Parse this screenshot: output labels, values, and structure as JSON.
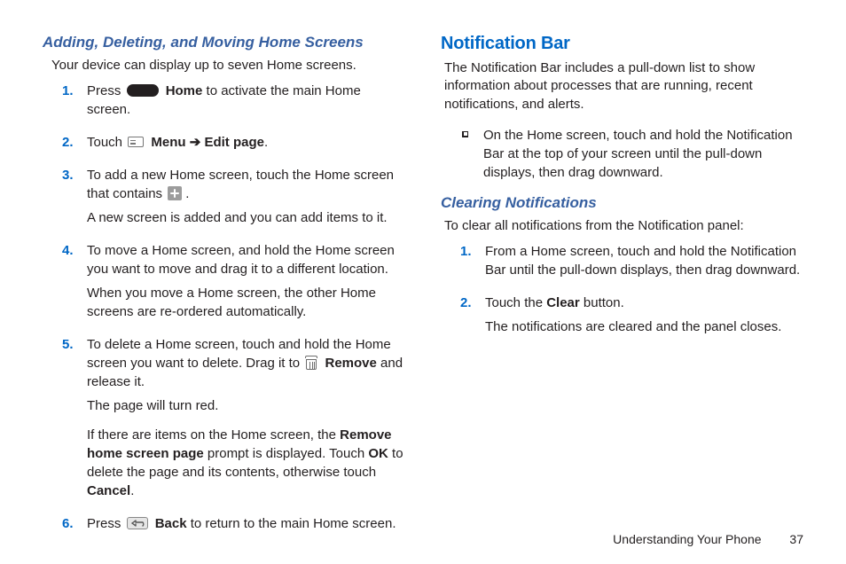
{
  "left": {
    "heading": "Adding, Deleting, and Moving Home Screens",
    "intro": "Your device can display up to seven Home screens.",
    "steps": {
      "s1a": "Press ",
      "s1b": "Home",
      "s1c": " to activate the main Home screen.",
      "s2a": "Touch ",
      "s2b": "Menu",
      "s2c": "Edit page",
      "s2d": ".",
      "arrow": " ➔ ",
      "s3a": "To add a new Home screen, touch the Home screen that contains ",
      "s3b": ".",
      "s3c": "A new screen is added and you can add items to it.",
      "s4a": "To move a Home screen, and hold the Home screen you want to move and drag it to a different location.",
      "s4b": "When you move a Home screen, the other Home screens are re-ordered automatically.",
      "s5a": "To delete a Home screen, touch and hold the Home screen you want to delete. Drag it to ",
      "s5b": "Remove",
      "s5c": " and release it.",
      "s5d": "The page will turn red.",
      "s5e": "If there are items on the Home screen, the ",
      "s5f": "Remove home screen page",
      "s5g": " prompt is displayed. Touch ",
      "s5h": "OK",
      "s5i": " to delete the page and its contents, otherwise touch ",
      "s5j": "Cancel",
      "s5k": ".",
      "s6a": "Press ",
      "s6b": "Back",
      "s6c": " to return to the main Home screen."
    }
  },
  "right": {
    "heading": "Notification Bar",
    "intro": "The Notification Bar includes a pull-down list to show information about processes that are running, recent notifications, and alerts.",
    "bullet": "On the Home screen, touch and hold the Notification Bar at the top of your screen until the pull-down displays, then drag downward.",
    "sub_heading": "Clearing Notifications",
    "sub_intro": "To clear all notifications from the Notification panel:",
    "steps": {
      "s1": "From a Home screen, touch and hold the Notification Bar until the pull-down displays, then drag downward.",
      "s2a": "Touch the ",
      "s2b": "Clear",
      "s2c": " button.",
      "s2d": "The notifications are cleared and the panel closes."
    }
  },
  "footer": {
    "section": "Understanding Your Phone",
    "page": "37"
  }
}
